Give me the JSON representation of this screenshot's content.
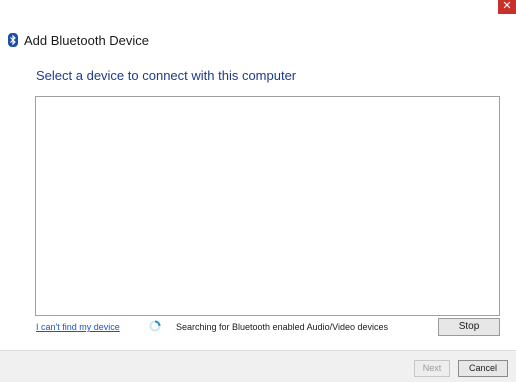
{
  "window": {
    "title": "Add Bluetooth Device",
    "close_glyph": "✕",
    "title_icon": "bluetooth-icon"
  },
  "main": {
    "heading": "Select a device to connect with this computer",
    "help_link": "I can't find my device",
    "status": "Searching for Bluetooth enabled Audio/Video devices",
    "stop_label": "Stop",
    "spinner_icon": "loading-spinner-icon"
  },
  "footer": {
    "next_label": "Next",
    "cancel_label": "Cancel"
  },
  "colors": {
    "heading": "#1e3a8a",
    "link": "#1a56c4",
    "close_button": "#c7312a",
    "spinner": "#2a8fd6",
    "footer_bg": "#f0f0f0"
  }
}
